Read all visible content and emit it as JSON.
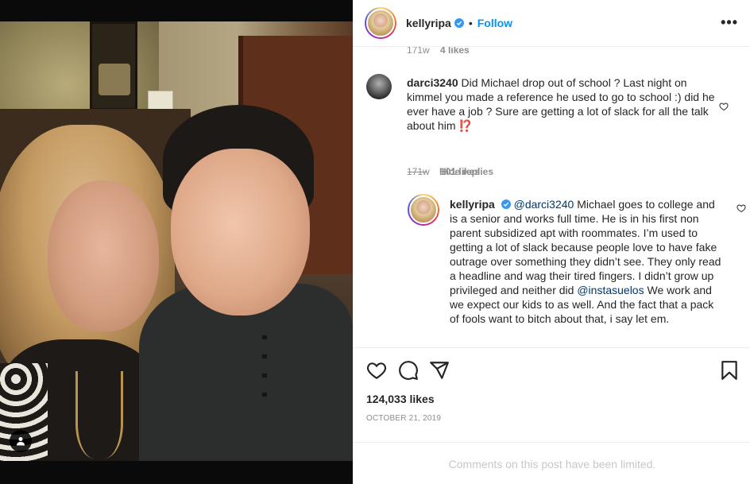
{
  "header": {
    "username": "kellyripa",
    "separator": "•",
    "follow_label": "Follow",
    "more_label": "•••"
  },
  "top_comment_meta": {
    "age": "171w",
    "likes": "4 likes"
  },
  "comment": {
    "username": "darci3240",
    "text": "Did Michael drop out of school ? Last night on kimmel you made a reference he used to go to school :) did he ever have a job ? Sure are getting a lot of slack for all the talk about him ⁉️",
    "age": "171w",
    "likes": "101 likes"
  },
  "hide_replies_label": "Hide replies",
  "reply": {
    "username": "kellyripa",
    "mention1": "@darci3240",
    "text1": "Michael goes to college and is a senior and works full time. He is in his first non parent subsidized apt with roommates. I’m used to getting a lot of slack because people love to have fake outrage over something they didn’t see. They only read a headline and wag their tired fingers. I didn’t grow up privileged and neither did",
    "mention2": "@instasuelos",
    "text2": "We work and we expect our kids to as well. And the fact that a pack of fools want to bitch about that, i say let em."
  },
  "post": {
    "likes": "124,033 likes",
    "date": "OCTOBER 21, 2019",
    "comments_limited": "Comments on this post have been limited."
  },
  "icons": {
    "like": "heart-icon",
    "comment": "comment-bubble-icon",
    "share": "paper-plane-icon",
    "save": "bookmark-icon",
    "verified": "verified-badge-icon",
    "tag": "user-tag-icon"
  },
  "colors": {
    "accent": "#0095f6",
    "text": "#262626",
    "muted": "#8e8e8e",
    "mention": "#00376b",
    "limited": "#c7c7c7"
  }
}
